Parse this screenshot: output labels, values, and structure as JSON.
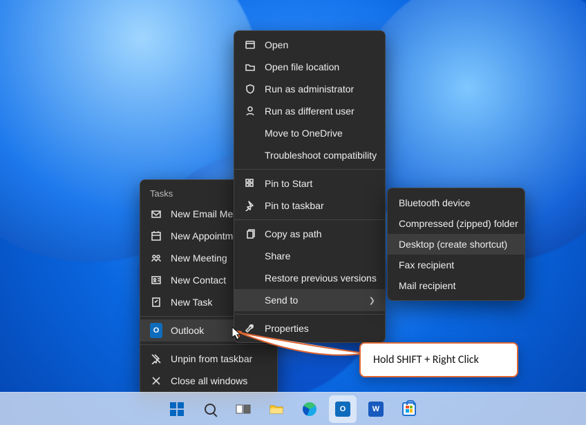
{
  "tasks": {
    "header": "Tasks",
    "items": [
      {
        "label": "New Email Message",
        "icon": "mail"
      },
      {
        "label": "New Appointment",
        "icon": "calendar"
      },
      {
        "label": "New Meeting",
        "icon": "meeting"
      },
      {
        "label": "New Contact",
        "icon": "contact"
      },
      {
        "label": "New Task",
        "icon": "task"
      }
    ],
    "app": {
      "label": "Outlook",
      "icon": "outlook"
    },
    "actions": [
      {
        "label": "Unpin from taskbar",
        "icon": "unpin"
      },
      {
        "label": "Close all windows",
        "icon": "close"
      }
    ]
  },
  "ctx": {
    "groups": [
      [
        {
          "label": "Open",
          "icon": "open"
        },
        {
          "label": "Open file location",
          "icon": "folder"
        },
        {
          "label": "Run as administrator",
          "icon": "shield"
        },
        {
          "label": "Run as different user",
          "icon": "user"
        },
        {
          "label": "Move to OneDrive",
          "icon": ""
        },
        {
          "label": "Troubleshoot compatibility",
          "icon": ""
        }
      ],
      [
        {
          "label": "Pin to Start",
          "icon": "pin-grid"
        },
        {
          "label": "Pin to taskbar",
          "icon": "pin"
        }
      ],
      [
        {
          "label": "Copy as path",
          "icon": "copy"
        },
        {
          "label": "Share",
          "icon": ""
        },
        {
          "label": "Restore previous versions",
          "icon": ""
        },
        {
          "label": "Send to",
          "icon": "",
          "submenu": true,
          "hovered": true
        }
      ],
      [
        {
          "label": "Properties",
          "icon": "wrench"
        }
      ]
    ]
  },
  "sendto": {
    "items": [
      "Bluetooth device",
      "Compressed (zipped) folder",
      "Desktop (create shortcut)",
      "Fax recipient",
      "Mail recipient"
    ],
    "hovered_index": 2
  },
  "callout": {
    "text": "Hold SHIFT + Right Click"
  },
  "taskbar": {
    "items": [
      {
        "name": "start",
        "tip": "Start"
      },
      {
        "name": "search",
        "tip": "Search"
      },
      {
        "name": "taskview",
        "tip": "Task View"
      },
      {
        "name": "explorer",
        "tip": "File Explorer"
      },
      {
        "name": "edge",
        "tip": "Microsoft Edge"
      },
      {
        "name": "outlook",
        "tip": "Outlook",
        "active": true
      },
      {
        "name": "word",
        "tip": "Word"
      },
      {
        "name": "store",
        "tip": "Microsoft Store"
      }
    ]
  }
}
